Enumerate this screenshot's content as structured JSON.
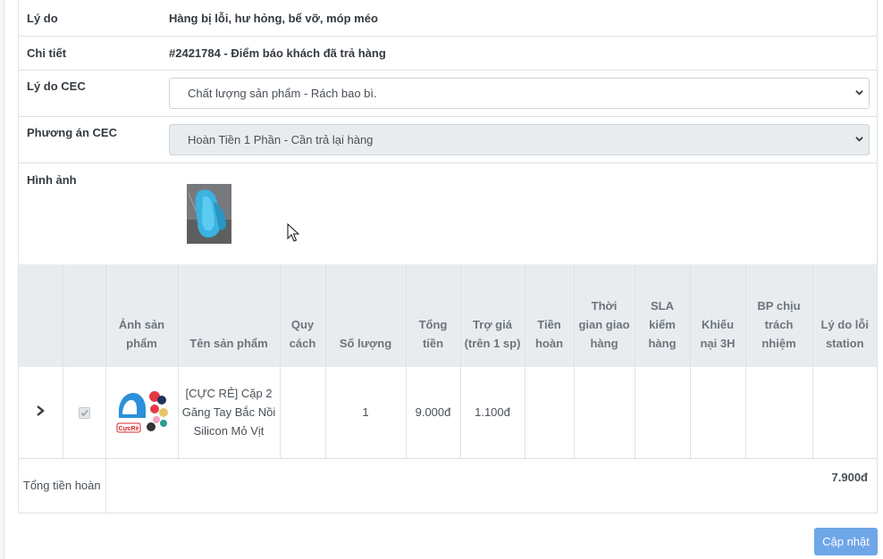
{
  "form": {
    "reason": {
      "label": "Lý do",
      "value": "Hàng bị lỗi, hư hỏng, bể vỡ, móp méo"
    },
    "detail": {
      "label": "Chi tiết",
      "value": "#2421784 - Điểm báo khách đã trả hàng"
    },
    "cec_reason": {
      "label": "Lý do CEC",
      "selected": "Chất lượng sản phẩm - Rách bao bì."
    },
    "cec_plan": {
      "label": "Phương án CEC",
      "selected": "Hoàn Tiền 1 Phần - Cần trả lại hàng"
    },
    "images": {
      "label": "Hình ảnh"
    }
  },
  "table": {
    "headers": {
      "image": "Ảnh sản phẩm",
      "name": "Tên sản phẩm",
      "spec": "Quy cách",
      "qty": "Số lượng",
      "total": "Tổng tiền",
      "subsidy": "Trợ giá (trên 1 sp)",
      "refund": "Tiền hoàn",
      "delivery_time": "Thời gian giao hàng",
      "sla": "SLA kiểm hàng",
      "complaint": "Khiếu nại 3H",
      "responsible": "BP chịu trách nhiệm",
      "station_reason": "Lý do lỗi station"
    },
    "rows": [
      {
        "name": "[CỰC RẺ] Cặp 2 Găng Tay Bắc Nồi Silicon Mỏ Vịt",
        "spec": "",
        "qty": "1",
        "total": "9.000đ",
        "subsidy": "1.100đ",
        "refund": "",
        "delivery_time": "",
        "sla": "",
        "complaint": "",
        "responsible": "",
        "station_reason": ""
      }
    ],
    "footer": {
      "label": "Tổng tiền hoàn",
      "value": "7.900đ"
    }
  },
  "actions": {
    "update_label": "Cập nhật"
  },
  "colors": {
    "header_bg": "#e9ecef",
    "button": "#6fa6e8",
    "border": "#dee2e6"
  }
}
